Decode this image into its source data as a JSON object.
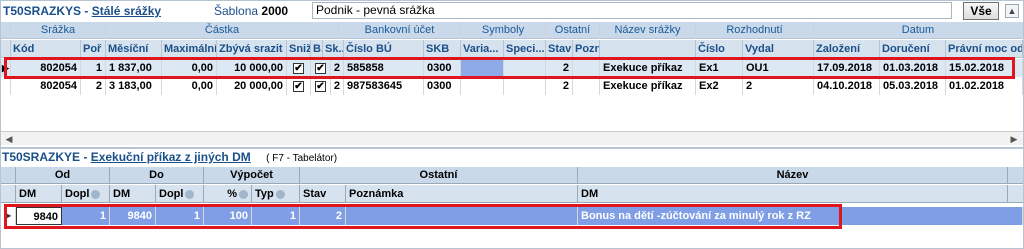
{
  "top_panel": {
    "code": "T50SRAZKYS",
    "separator": " - ",
    "title": "Stálé srážky",
    "template_label": "Šablona",
    "template_value": "2000",
    "template_name": "Podnik - pevná srážka",
    "all_button": "Vše",
    "group_headers": [
      "Srážka",
      "Částka",
      "Bankovní účet",
      "Symboly",
      "Ostatní",
      "Název srážky",
      "Rozhodnutí",
      "Datum"
    ],
    "columns": [
      "Kód",
      "Poř",
      "Měsíční",
      "Maximální",
      "Zbývá srazit",
      "Sniž",
      "B.",
      "Sk...",
      "Číslo BÚ",
      "SKB",
      "Varia...",
      "Speci...",
      "Stav",
      "Pozn",
      "",
      "Číslo",
      "Vydal",
      "Založení",
      "Doručení",
      "Právní moc od"
    ],
    "rows": [
      {
        "kod": "802054",
        "por": "1",
        "mesicni": "1 837,00",
        "max": "0,00",
        "zbyva": "10 000,00",
        "sniz": "✔",
        "b": "✔",
        "sk": "2",
        "cislo_bu": "585858",
        "skb": "0300",
        "var": "",
        "spec": "",
        "stav": "2",
        "pozn": "",
        "nazev": "Exekuce příkaz",
        "cislo": "Ex1",
        "vydal": "OU1",
        "zalozeni": "17.09.2018",
        "doruceni": "01.03.2018",
        "pravni": "15.02.2018"
      },
      {
        "kod": "802054",
        "por": "2",
        "mesicni": "3 183,00",
        "max": "0,00",
        "zbyva": "20 000,00",
        "sniz": "✔",
        "b": "✔",
        "sk": "2",
        "cislo_bu": "987583645",
        "skb": "0300",
        "var": "",
        "spec": "",
        "stav": "2",
        "pozn": "",
        "nazev": "Exekuce příkaz",
        "cislo": "Ex2",
        "vydal": "2",
        "zalozeni": "04.10.2018",
        "doruceni": "05.03.2018",
        "pravni": "01.02.2018"
      }
    ]
  },
  "bottom_panel": {
    "code": "T50SRAZKYE",
    "separator": " - ",
    "title": "Exekuční příkaz z jiných DM",
    "hint": "( F7 - Tabelátor)",
    "group_headers": [
      "Od",
      "Do",
      "Výpočet",
      "Ostatní",
      "Název"
    ],
    "columns": [
      "DM",
      "Dopl",
      "DM",
      "Dopl",
      "%",
      "Typ",
      "Stav",
      "Poznámka",
      "DM"
    ],
    "rows": [
      {
        "dm_od": "9840",
        "dopl_od": "1",
        "dm_do": "9840",
        "dopl_do": "1",
        "pct": "100",
        "typ": "1",
        "stav": "2",
        "poznamka": "",
        "nazev": "Bonus na dětí -zúčtování za minulý rok z RZ"
      }
    ]
  },
  "colors": {
    "header_bg": "#c9d9ea",
    "selected_row": "#7f9ee6",
    "highlight": "#e0161e",
    "blue_text": "#1a5a9a"
  }
}
